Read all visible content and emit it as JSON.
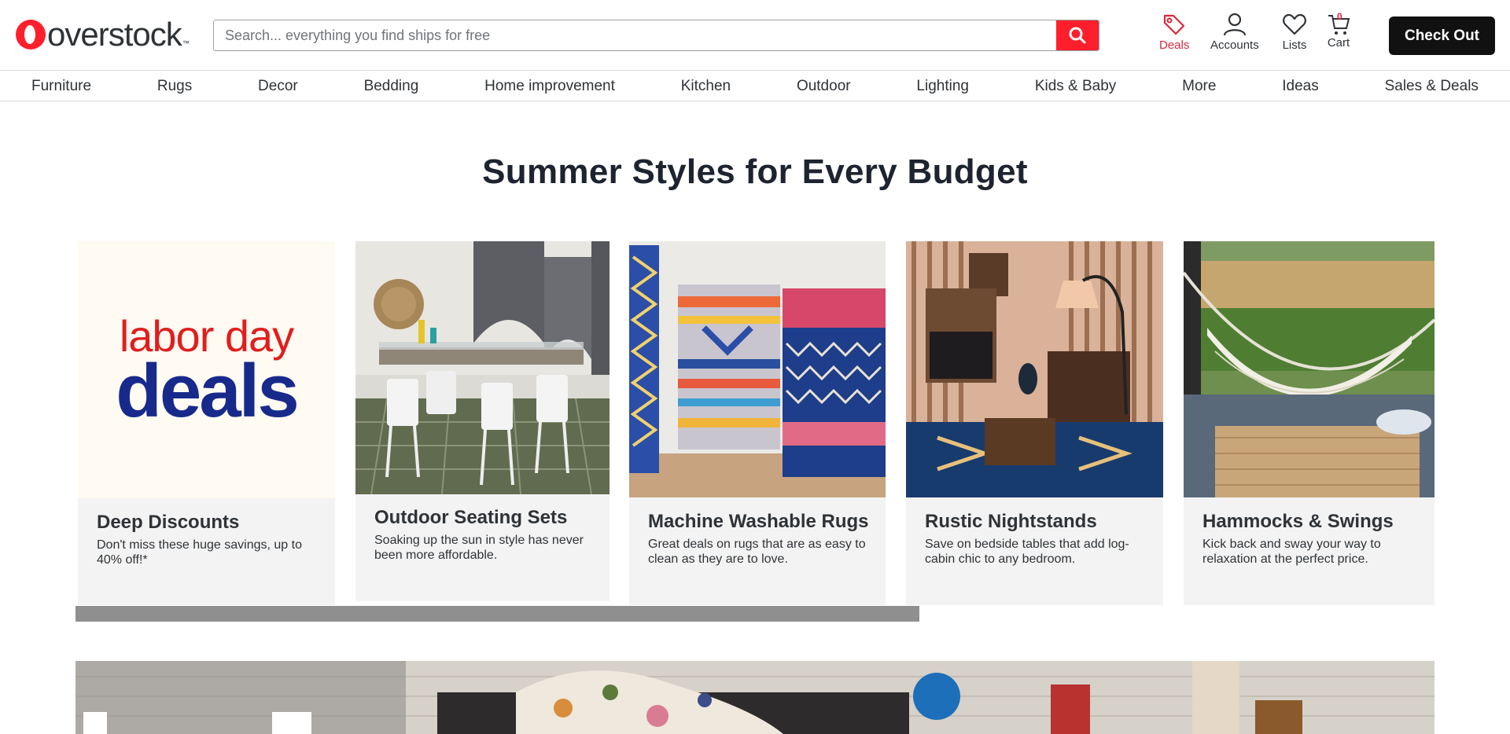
{
  "brand": {
    "name": "overstock",
    "tm": "™"
  },
  "search": {
    "placeholder": "Search... everything you find ships for free"
  },
  "header": {
    "deals_label": "Deals",
    "accounts_label": "Accounts",
    "lists_label": "Lists",
    "cart_label": "Cart",
    "cart_count": "0",
    "checkout_label": "Check Out"
  },
  "nav": {
    "items": [
      "Furniture",
      "Rugs",
      "Decor",
      "Bedding",
      "Home improvement",
      "Kitchen",
      "Outdoor",
      "Lighting",
      "Kids & Baby",
      "More",
      "Ideas",
      "Sales & Deals"
    ]
  },
  "section": {
    "title": "Summer Styles for Every Budget"
  },
  "cards": [
    {
      "title": "Deep Discounts",
      "desc": "Don't miss these huge savings, up to 40% off!*",
      "promo_line1": "labor day",
      "promo_line2": "deals"
    },
    {
      "title": "Outdoor Seating Sets",
      "desc": "Soaking up the sun in style has never been more affordable."
    },
    {
      "title": "Machine Washable Rugs",
      "desc": "Great deals on rugs that are as easy to clean as they are to love."
    },
    {
      "title": "Rustic Nightstands",
      "desc": "Save on bedside tables that add log-cabin chic to any bedroom."
    },
    {
      "title": "Hammocks & Swings",
      "desc": "Kick back and sway your way to relaxation at the perfect price."
    }
  ],
  "colors": {
    "accent": "#ff1f2c",
    "deals": "#d8293a",
    "promo_red": "#e01e1e",
    "promo_blue": "#172a8c",
    "card_bg": "#f3f3f3"
  }
}
